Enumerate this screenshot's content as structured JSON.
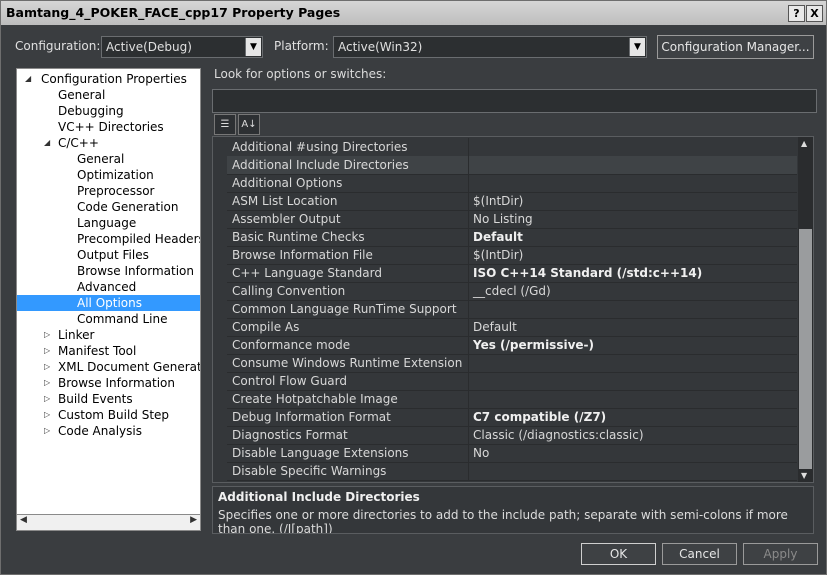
{
  "window": {
    "title": "Bamtang_4_POKER_FACE_cpp17 Property Pages",
    "help_glyph": "?",
    "close_glyph": "X"
  },
  "config": {
    "label": "Configuration:",
    "value": "Active(Debug)"
  },
  "platform": {
    "label": "Platform:",
    "value": "Active(Win32)"
  },
  "config_manager_label": "Configuration Manager...",
  "search": {
    "label": "Look for options or switches:",
    "placeholder": ""
  },
  "tree": [
    {
      "label": "Configuration Properties",
      "level": 0,
      "expanded": true
    },
    {
      "label": "General",
      "level": 1
    },
    {
      "label": "Debugging",
      "level": 1
    },
    {
      "label": "VC++ Directories",
      "level": 1
    },
    {
      "label": "C/C++",
      "level": 1,
      "expanded": true
    },
    {
      "label": "General",
      "level": 2
    },
    {
      "label": "Optimization",
      "level": 2
    },
    {
      "label": "Preprocessor",
      "level": 2
    },
    {
      "label": "Code Generation",
      "level": 2
    },
    {
      "label": "Language",
      "level": 2
    },
    {
      "label": "Precompiled Headers",
      "level": 2
    },
    {
      "label": "Output Files",
      "level": 2
    },
    {
      "label": "Browse Information",
      "level": 2
    },
    {
      "label": "Advanced",
      "level": 2
    },
    {
      "label": "All Options",
      "level": 2,
      "selected": true
    },
    {
      "label": "Command Line",
      "level": 2
    },
    {
      "label": "Linker",
      "level": 1,
      "collapsed": true
    },
    {
      "label": "Manifest Tool",
      "level": 1,
      "collapsed": true
    },
    {
      "label": "XML Document Generator",
      "level": 1,
      "collapsed": true
    },
    {
      "label": "Browse Information",
      "level": 1,
      "collapsed": true
    },
    {
      "label": "Build Events",
      "level": 1,
      "collapsed": true
    },
    {
      "label": "Custom Build Step",
      "level": 1,
      "collapsed": true
    },
    {
      "label": "Code Analysis",
      "level": 1,
      "collapsed": true
    }
  ],
  "properties": [
    {
      "name": "Additional #using Directories",
      "value": ""
    },
    {
      "name": "Additional Include Directories",
      "value": "",
      "selected": true
    },
    {
      "name": "Additional Options",
      "value": ""
    },
    {
      "name": "ASM List Location",
      "value": "$(IntDir)"
    },
    {
      "name": "Assembler Output",
      "value": "No Listing"
    },
    {
      "name": "Basic Runtime Checks",
      "value": "Default",
      "bold": true
    },
    {
      "name": "Browse Information File",
      "value": "$(IntDir)"
    },
    {
      "name": "C++ Language Standard",
      "value": "ISO C++14 Standard (/std:c++14)",
      "bold": true
    },
    {
      "name": "Calling Convention",
      "value": "__cdecl (/Gd)"
    },
    {
      "name": "Common Language RunTime Support",
      "value": ""
    },
    {
      "name": "Compile As",
      "value": "Default"
    },
    {
      "name": "Conformance mode",
      "value": "Yes (/permissive-)",
      "bold": true
    },
    {
      "name": "Consume Windows Runtime Extension",
      "value": ""
    },
    {
      "name": "Control Flow Guard",
      "value": ""
    },
    {
      "name": "Create Hotpatchable Image",
      "value": ""
    },
    {
      "name": "Debug Information Format",
      "value": "C7 compatible (/Z7)",
      "bold": true
    },
    {
      "name": "Diagnostics Format",
      "value": "Classic (/diagnostics:classic)"
    },
    {
      "name": "Disable Language Extensions",
      "value": "No"
    },
    {
      "name": "Disable Specific Warnings",
      "value": ""
    }
  ],
  "description": {
    "title": "Additional Include Directories",
    "text": "Specifies one or more directories to add to the include path; separate with semi-colons if more than one. (/I[path])"
  },
  "buttons": {
    "ok": "OK",
    "cancel": "Cancel",
    "apply": "Apply"
  },
  "icons": {
    "categorized": "categorized-view-icon",
    "alphabetical": "alphabetical-sort-icon"
  }
}
